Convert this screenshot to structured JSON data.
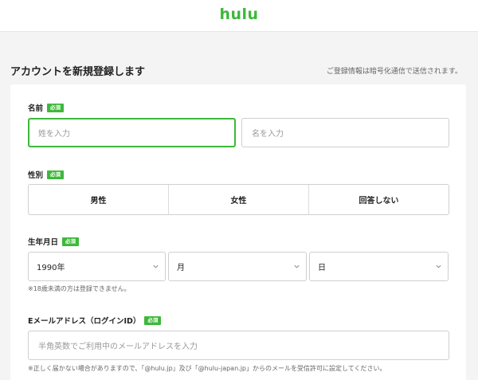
{
  "header": {
    "logo_text": "hulu"
  },
  "page": {
    "title": "アカウントを新規登録します",
    "security_notice": "ご登録情報は暗号化通信で送信されます。"
  },
  "form": {
    "required_badge": "必須",
    "name": {
      "label": "名前",
      "last_name_placeholder": "姓を入力",
      "first_name_placeholder": "名を入力"
    },
    "gender": {
      "label": "性別",
      "options": [
        "男性",
        "女性",
        "回答しない"
      ]
    },
    "birthdate": {
      "label": "生年月日",
      "year_value": "1990年",
      "month_value": "月",
      "day_value": "日",
      "note": "※18歳未満の方は登録できません。"
    },
    "email": {
      "label": "Eメールアドレス（ログインID）",
      "placeholder": "半角英数でご利用中のメールアドレスを入力",
      "note": "※正しく届かない場合がありますので、「@hulu.jp」及び「@hulu-japan.jp」からのメールを受信許可に設定してください。"
    }
  },
  "colors": {
    "accent": "#3db83a",
    "background": "#f4f4f4",
    "card": "#ffffff"
  }
}
